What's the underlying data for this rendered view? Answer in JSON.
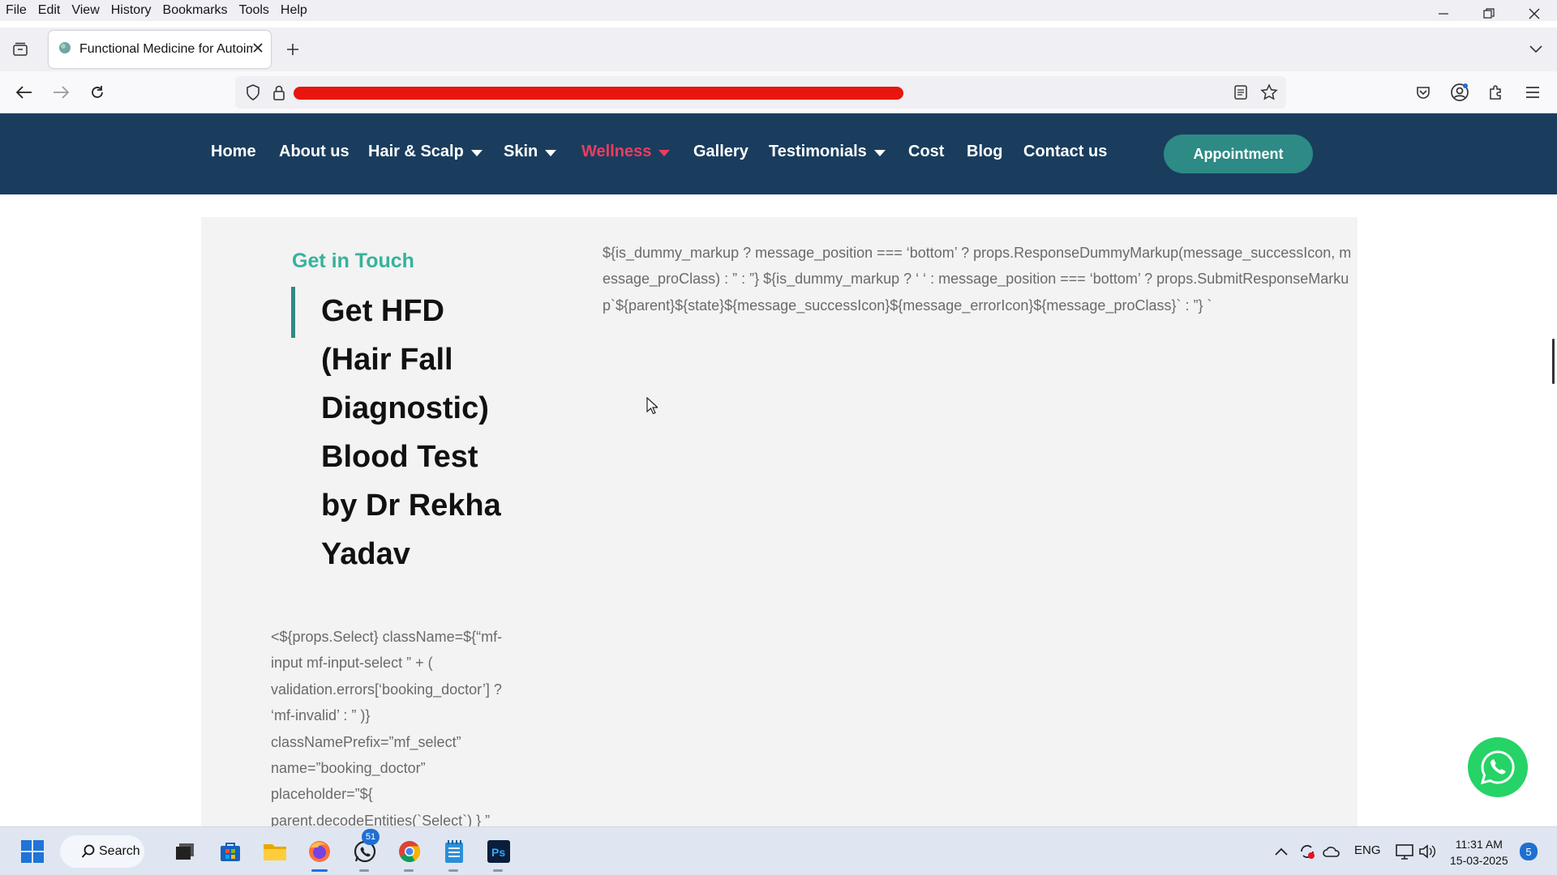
{
  "browser": {
    "menu": [
      "File",
      "Edit",
      "View",
      "History",
      "Bookmarks",
      "Tools",
      "Help"
    ],
    "tab_title": "Functional Medicine for Autoim",
    "url_redacted": true
  },
  "site_nav": {
    "items": [
      {
        "label": "Home",
        "dropdown": false,
        "active": false
      },
      {
        "label": "About us",
        "dropdown": false,
        "active": false
      },
      {
        "label": "Hair & Scalp",
        "dropdown": true,
        "active": false
      },
      {
        "label": "Skin",
        "dropdown": true,
        "active": false
      },
      {
        "label": "Wellness",
        "dropdown": true,
        "active": true
      },
      {
        "label": "Gallery",
        "dropdown": false,
        "active": false
      },
      {
        "label": "Testimonials",
        "dropdown": true,
        "active": false
      },
      {
        "label": "Cost",
        "dropdown": false,
        "active": false
      },
      {
        "label": "Blog",
        "dropdown": false,
        "active": false
      },
      {
        "label": "Contact us",
        "dropdown": false,
        "active": false
      }
    ],
    "appointment_label": "Appointment",
    "active_color": "#ef3c5d",
    "bg_color": "#1a3d5e"
  },
  "content": {
    "eyebrow": "Get in Touch",
    "heading_lines": [
      "Get HFD",
      "(Hair Fall",
      "Diagnostic)",
      "Blood Test",
      "by Dr Rekha",
      "Yadav"
    ],
    "left_code": "<${props.Select} className=${“mf-input mf-input-select ” + ( validation.errors[‘booking_doctor’] ? ‘mf-invalid’ : ” )} classNamePrefix=”mf_select” name=”booking_doctor” placeholder=”${ parent.decodeEntities(`Select`) } ”",
    "right_code": "${is_dummy_markup ? message_position === ‘bottom’ ? props.ResponseDummyMarkup(message_successIcon, message_proClass) : ” : ”} ${is_dummy_markup ? ‘ ‘ : message_position === ‘bottom’ ? props.SubmitResponseMarkup`${parent}${state}${message_successIcon}${message_errorIcon}${message_proClass}` : ”} `"
  },
  "taskbar": {
    "search_label": "Search",
    "whatsapp_badge": "51",
    "lang": "ENG",
    "time": "11:31 AM",
    "date": "15-03-2025",
    "notif_count": "5"
  }
}
